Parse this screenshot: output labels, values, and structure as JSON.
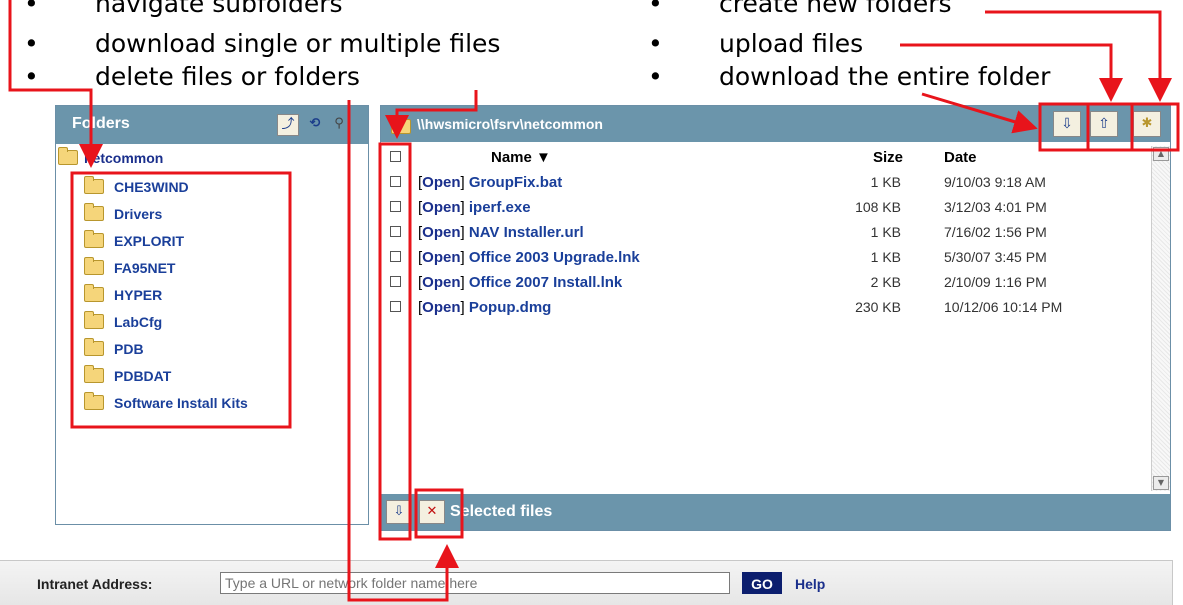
{
  "bullets_left": [
    {
      "text": "navigate subfolders"
    },
    {
      "text": "download single or multiple files"
    },
    {
      "text": "delete files or folders"
    }
  ],
  "bullets_right": [
    {
      "text": "create new folders"
    },
    {
      "text": "upload files"
    },
    {
      "text": "download the entire folder"
    }
  ],
  "bullet_symbol": "•",
  "folders_panel": {
    "title": "Folders",
    "root": "netcommon",
    "items": [
      "CHE3WIND",
      "Drivers",
      "EXPLORIT",
      "FA95NET",
      "HYPER",
      "LabCfg",
      "PDB",
      "PDBDAT",
      "Software Install Kits"
    ]
  },
  "file_panel": {
    "path": "\\\\hwsmicro\\fsrv\\netcommon",
    "columns": {
      "name": "Name ▼",
      "size": "Size",
      "date": "Date"
    },
    "open_label": "Open",
    "files": [
      {
        "name": "GroupFix.bat",
        "size": "1 KB",
        "date": "9/10/03 9:18 AM"
      },
      {
        "name": "iperf.exe",
        "size": "108 KB",
        "date": "3/12/03 4:01 PM"
      },
      {
        "name": "NAV Installer.url",
        "size": "1 KB",
        "date": "7/16/02 1:56 PM"
      },
      {
        "name": "Office 2003 Upgrade.lnk",
        "size": "1 KB",
        "date": "5/30/07 3:45 PM"
      },
      {
        "name": "Office 2007 Install.lnk",
        "size": "2 KB",
        "date": "2/10/09 1:16 PM"
      },
      {
        "name": "Popup.dmg",
        "size": "230 KB",
        "date": "10/12/06 10:14 PM"
      }
    ],
    "footer_label": "Selected files"
  },
  "address_bar": {
    "label": "Intranet Address:",
    "placeholder": "Type a URL or network folder name here",
    "go_label": "GO",
    "help_label": "Help"
  },
  "colors": {
    "header": "#6b95ab",
    "annotation": "#e8141b",
    "link": "#1a3f9a"
  },
  "icons": [
    "up-folder-icon",
    "refresh-icon",
    "search-icon",
    "download-folder-icon",
    "upload-icon",
    "new-folder-icon",
    "download-selected-icon",
    "delete-selected-icon",
    "folder-icon"
  ]
}
